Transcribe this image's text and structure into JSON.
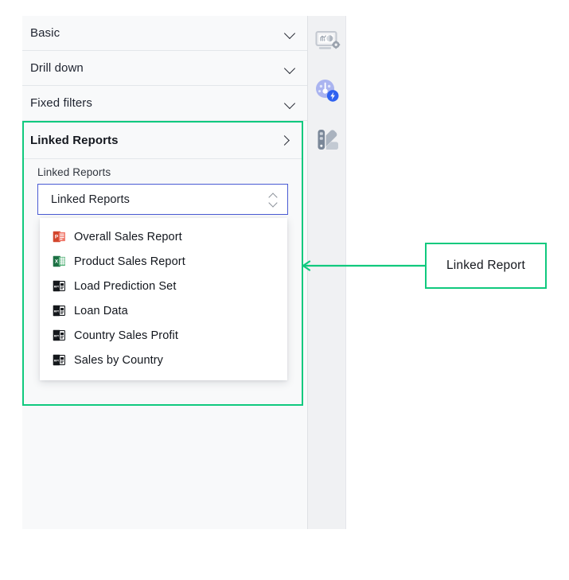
{
  "panel": {
    "accordions": [
      {
        "label": "Basic",
        "icon": "chevron-down-icon",
        "expanded": false
      },
      {
        "label": "Drill down",
        "icon": "chevron-down-icon",
        "expanded": false
      },
      {
        "label": "Fixed filters",
        "icon": "chevron-down-icon",
        "expanded": false
      }
    ],
    "linked_section": {
      "title": "Linked Reports",
      "toggle_icon": "chevron-right-icon",
      "field_label": "Linked Reports",
      "select": {
        "value": "Linked Reports",
        "placeholder": "Linked Reports",
        "stepper_icon": "chevron-up-down-icon",
        "border_color": "#4a5bd4",
        "open": true
      },
      "options": [
        {
          "label": "Overall Sales Report",
          "icon": "powerpoint-file-icon",
          "icon_color": "#d2452c"
        },
        {
          "label": "Product Sales Report",
          "icon": "excel-file-icon",
          "icon_color": "#1d7044"
        },
        {
          "label": "Load Prediction Set",
          "icon": "dark-report-file-icon",
          "icon_color": "#15181c"
        },
        {
          "label": "Loan Data",
          "icon": "dark-report-file-icon",
          "icon_color": "#15181c"
        },
        {
          "label": "Country Sales Profit",
          "icon": "dark-report-file-icon",
          "icon_color": "#15181c"
        },
        {
          "label": "Sales by Country",
          "icon": "dark-report-file-icon",
          "icon_color": "#15181c"
        }
      ]
    },
    "highlight_color": "#10c97e"
  },
  "toolbar": {
    "buttons": [
      {
        "name": "dashboard-settings-icon",
        "title": "Dashboard settings"
      },
      {
        "name": "gauge-performance-icon",
        "title": "Performance"
      },
      {
        "name": "color-palette-icon",
        "title": "Theme colors"
      }
    ]
  },
  "annotation": {
    "label": "Linked Report",
    "color": "#10c97e"
  }
}
